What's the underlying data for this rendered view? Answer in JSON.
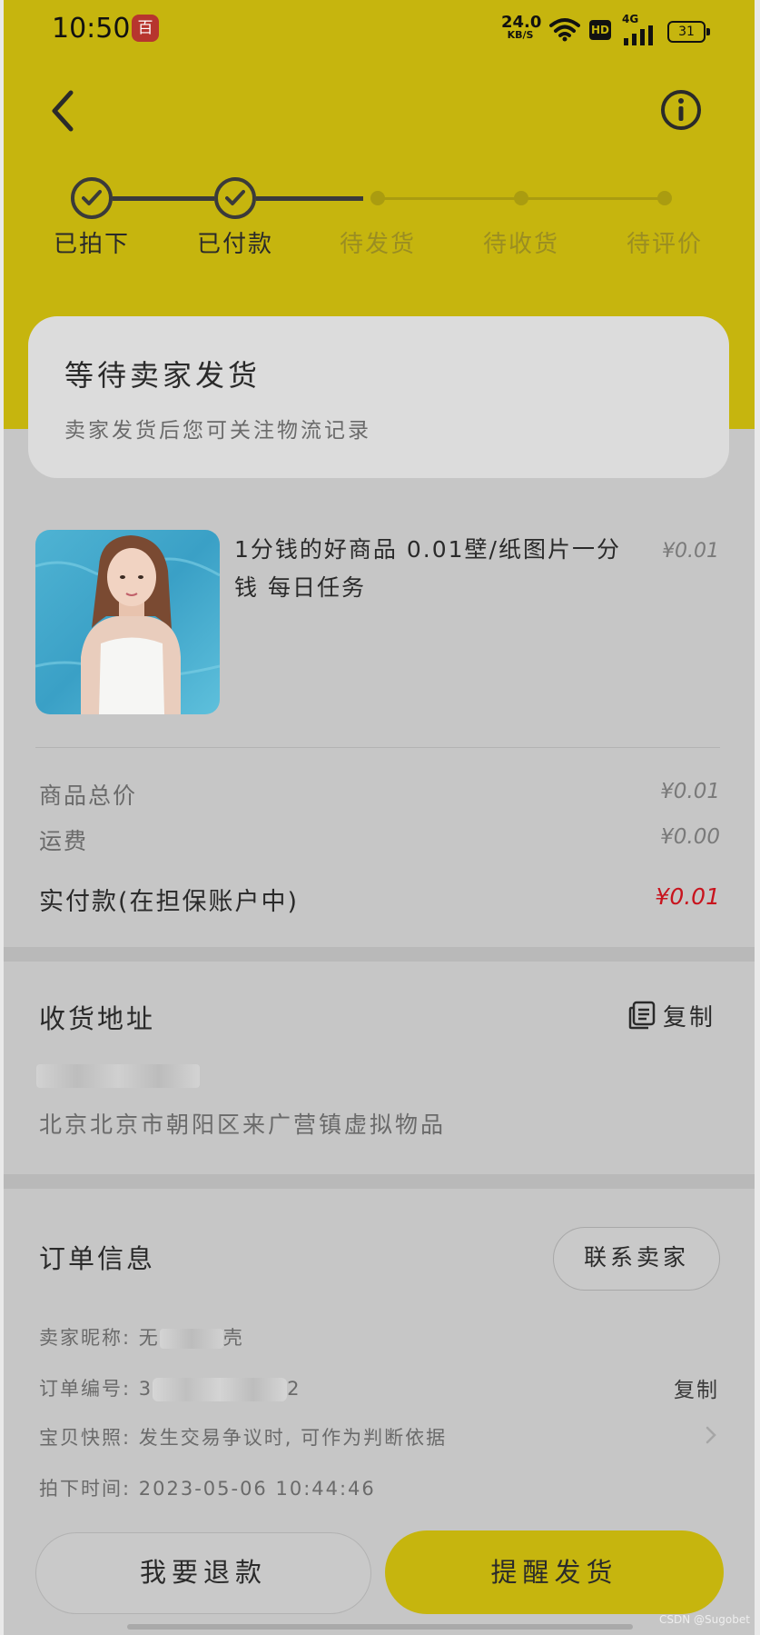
{
  "status_bar": {
    "time": "10:50",
    "notification_badge": "百",
    "net_speed_value": "24.0",
    "net_speed_unit": "KB/S",
    "hd_label": "HD",
    "network_type": "4G",
    "battery": "31"
  },
  "progress": {
    "steps": [
      {
        "label": "已拍下",
        "done": true
      },
      {
        "label": "已付款",
        "done": true
      },
      {
        "label": "待发货",
        "done": false
      },
      {
        "label": "待收货",
        "done": false
      },
      {
        "label": "待评价",
        "done": false
      }
    ]
  },
  "status_card": {
    "title": "等待卖家发货",
    "subtitle": "卖家发货后您可关注物流记录"
  },
  "product": {
    "title": "1分钱的好商品 0.01壁/纸图片一分钱 每日任务",
    "price": "¥0.01"
  },
  "summary": {
    "subtotal_label": "商品总价",
    "subtotal_value": "¥0.01",
    "shipping_label": "运费",
    "shipping_value": "¥0.00",
    "paid_label": "实付款(在担保账户中)",
    "paid_value": "¥0.01"
  },
  "address": {
    "title": "收货地址",
    "copy_label": "复制",
    "address_line": "北京北京市朝阳区来广营镇虚拟物品"
  },
  "order_info": {
    "title": "订单信息",
    "contact_label": "联系卖家",
    "seller_nick_label": "卖家昵称: 无",
    "seller_nick_tail": "壳",
    "order_no_label": "订单编号: 3",
    "order_no_tail": "2",
    "order_copy_label": "复制",
    "snapshot_text": "宝贝快照: 发生交易争议时, 可作为判断依据",
    "time_text": "拍下时间: 2023-05-06 10:44:46"
  },
  "bottom": {
    "refund_label": "我要退款",
    "remind_label": "提醒发货"
  },
  "watermark": "CSDN @Sugobet",
  "colors": {
    "brand_yellow": "#c6b50e",
    "price_red": "#c8141e",
    "background": "#c6c6c6"
  }
}
